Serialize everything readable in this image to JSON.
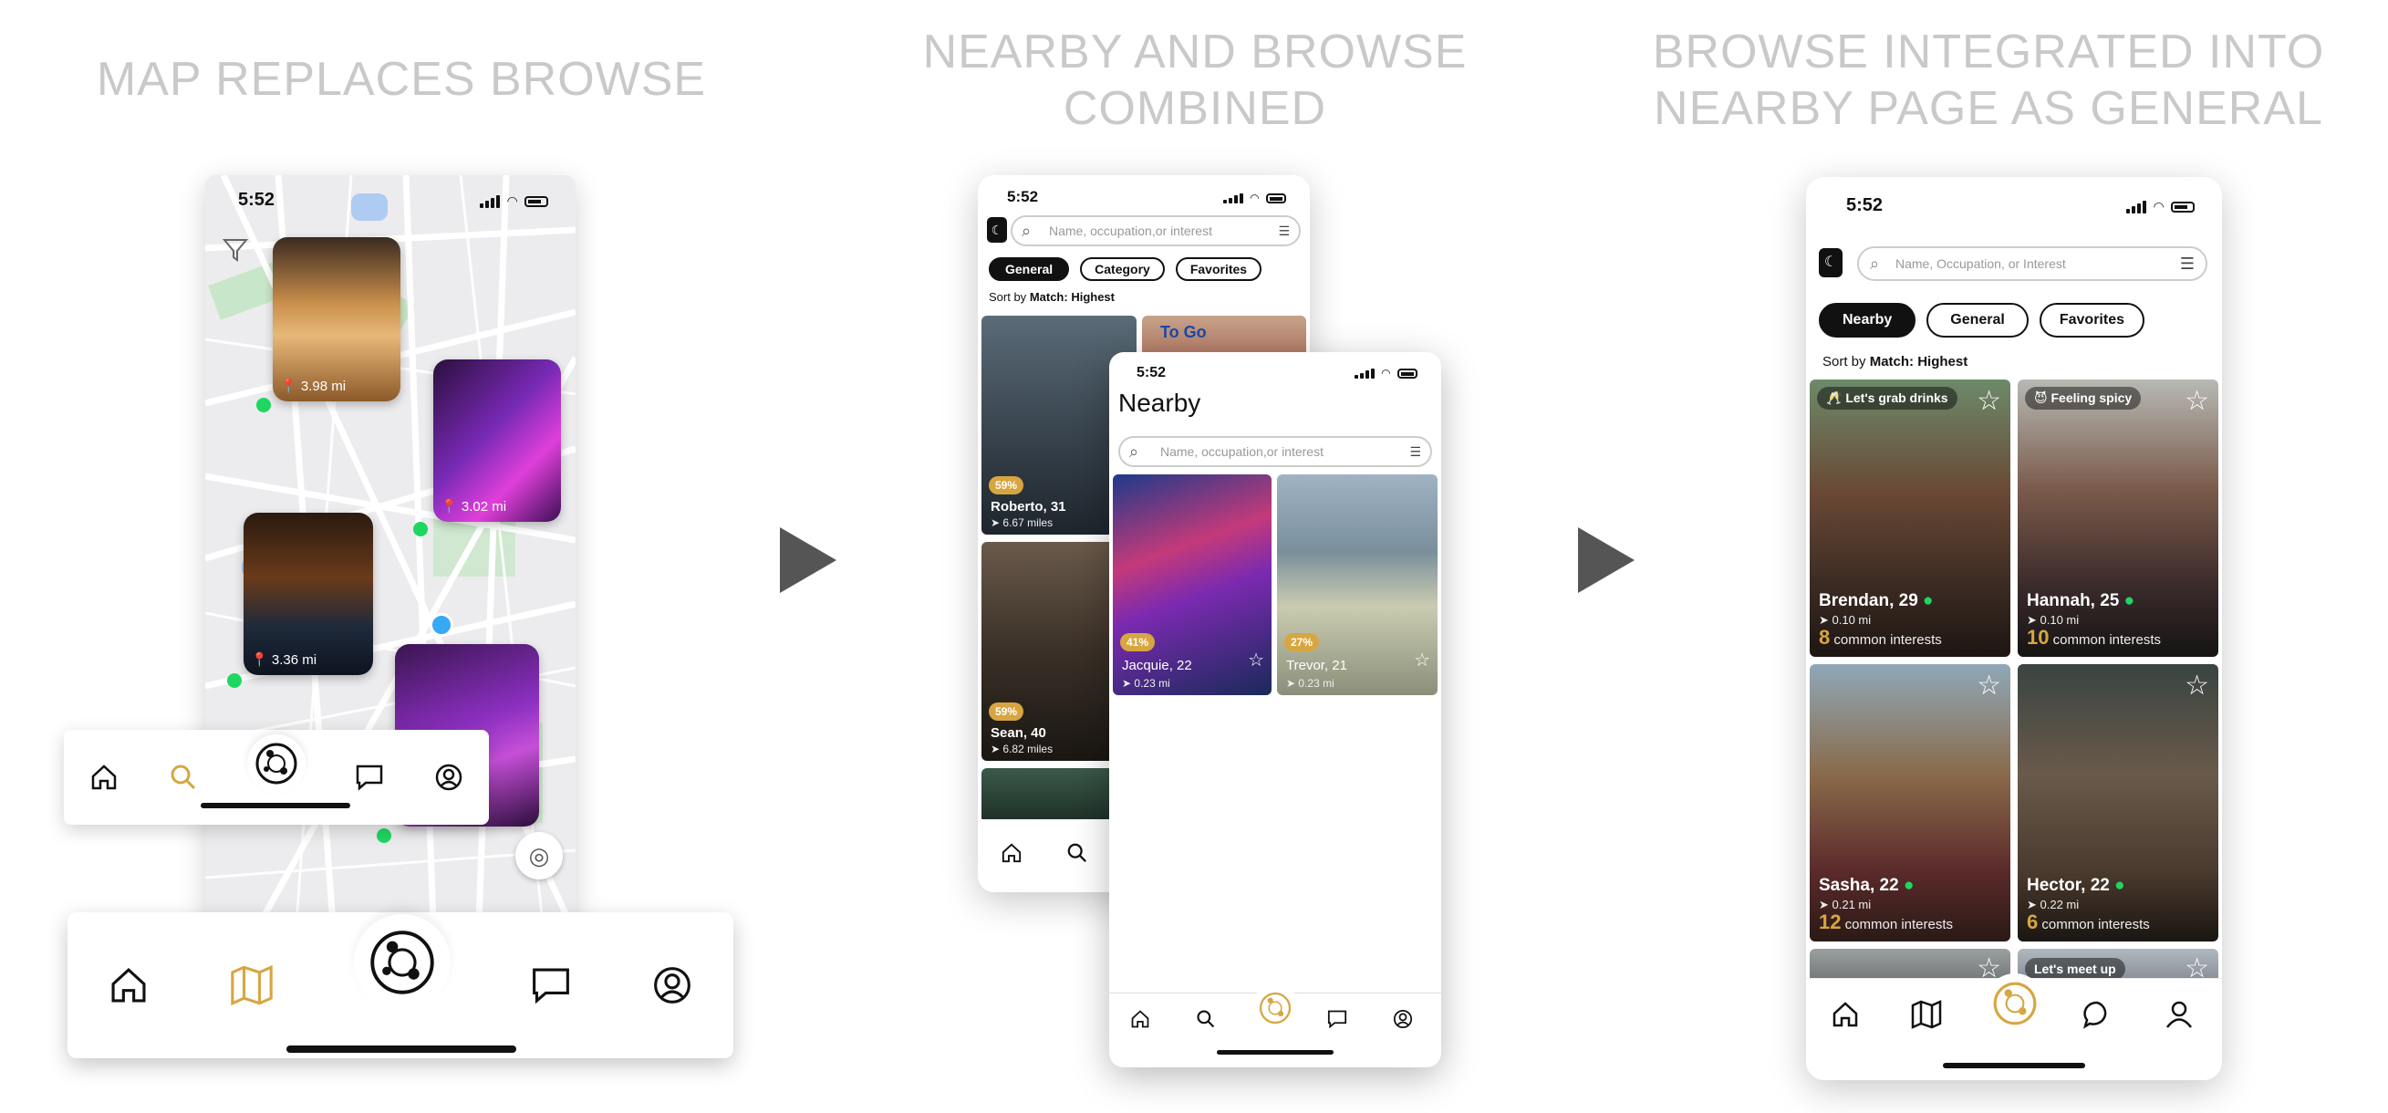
{
  "headings": {
    "panel1": "MAP REPLACES BROWSE",
    "panel2_line1": "NEARBY AND BROWSE",
    "panel2_line2": "COMBINED",
    "panel3_line1": "BROWSE INTEGRATED INTO",
    "panel3_line2": "NEARBY PAGE AS GENERAL"
  },
  "panel1": {
    "time": "5:52",
    "cards": [
      "3.98 mi",
      "3.02 mi",
      "3.36 mi"
    ],
    "small_nav": [
      "home-icon",
      "search-icon",
      "hub-icon",
      "chat-icon",
      "profile-icon"
    ],
    "big_nav": [
      "home-icon",
      "map-icon",
      "hub-icon",
      "chat-icon",
      "profile-icon"
    ]
  },
  "panel2_back": {
    "time": "5:52",
    "search_placeholder": "Name, occupation,or interest",
    "tabs": [
      "General",
      "Category",
      "Favorites"
    ],
    "sort_prefix": "Sort by",
    "sort_value": "Match: Highest",
    "profiles": [
      {
        "badge": "59%",
        "name": "Roberto, 31",
        "dist": "6.67 miles"
      },
      {
        "badge": "59%",
        "name": "Sean, 40",
        "dist": "6.82 miles"
      }
    ],
    "sign_text": "To Go"
  },
  "panel2_front": {
    "time": "5:52",
    "title": "Nearby",
    "search_placeholder": "Name, occupation,or interest",
    "profiles": [
      {
        "badge": "41%",
        "name": "Jacquie, 22",
        "dist": "0.23 mi"
      },
      {
        "badge": "27%",
        "name": "Trevor, 21",
        "dist": "0.23 mi"
      }
    ]
  },
  "panel3": {
    "time": "5:52",
    "search_placeholder": "Name, Occupation, or Interest",
    "tabs": [
      "Nearby",
      "General",
      "Favorites"
    ],
    "sort_prefix": "Sort by",
    "sort_value": "Match: Highest",
    "profiles": [
      {
        "tag": "🥂 Let's grab drinks",
        "name": "Brendan, 29",
        "dist": "0.10 mi",
        "count": "8",
        "interests": "common interests"
      },
      {
        "tag": "😈 Feeling spicy",
        "name": "Hannah, 25",
        "dist": "0.10 mi",
        "count": "10",
        "interests": "common interests"
      },
      {
        "tag": "",
        "name": "Sasha, 22",
        "dist": "0.21 mi",
        "count": "12",
        "interests": "common interests"
      },
      {
        "tag": "",
        "name": "Hector, 22",
        "dist": "0.22 mi",
        "count": "6",
        "interests": "common interests"
      }
    ],
    "peek_tag": "Let's meet up",
    "colors": {
      "accent": "#d7a640",
      "online": "#1ed760"
    }
  }
}
